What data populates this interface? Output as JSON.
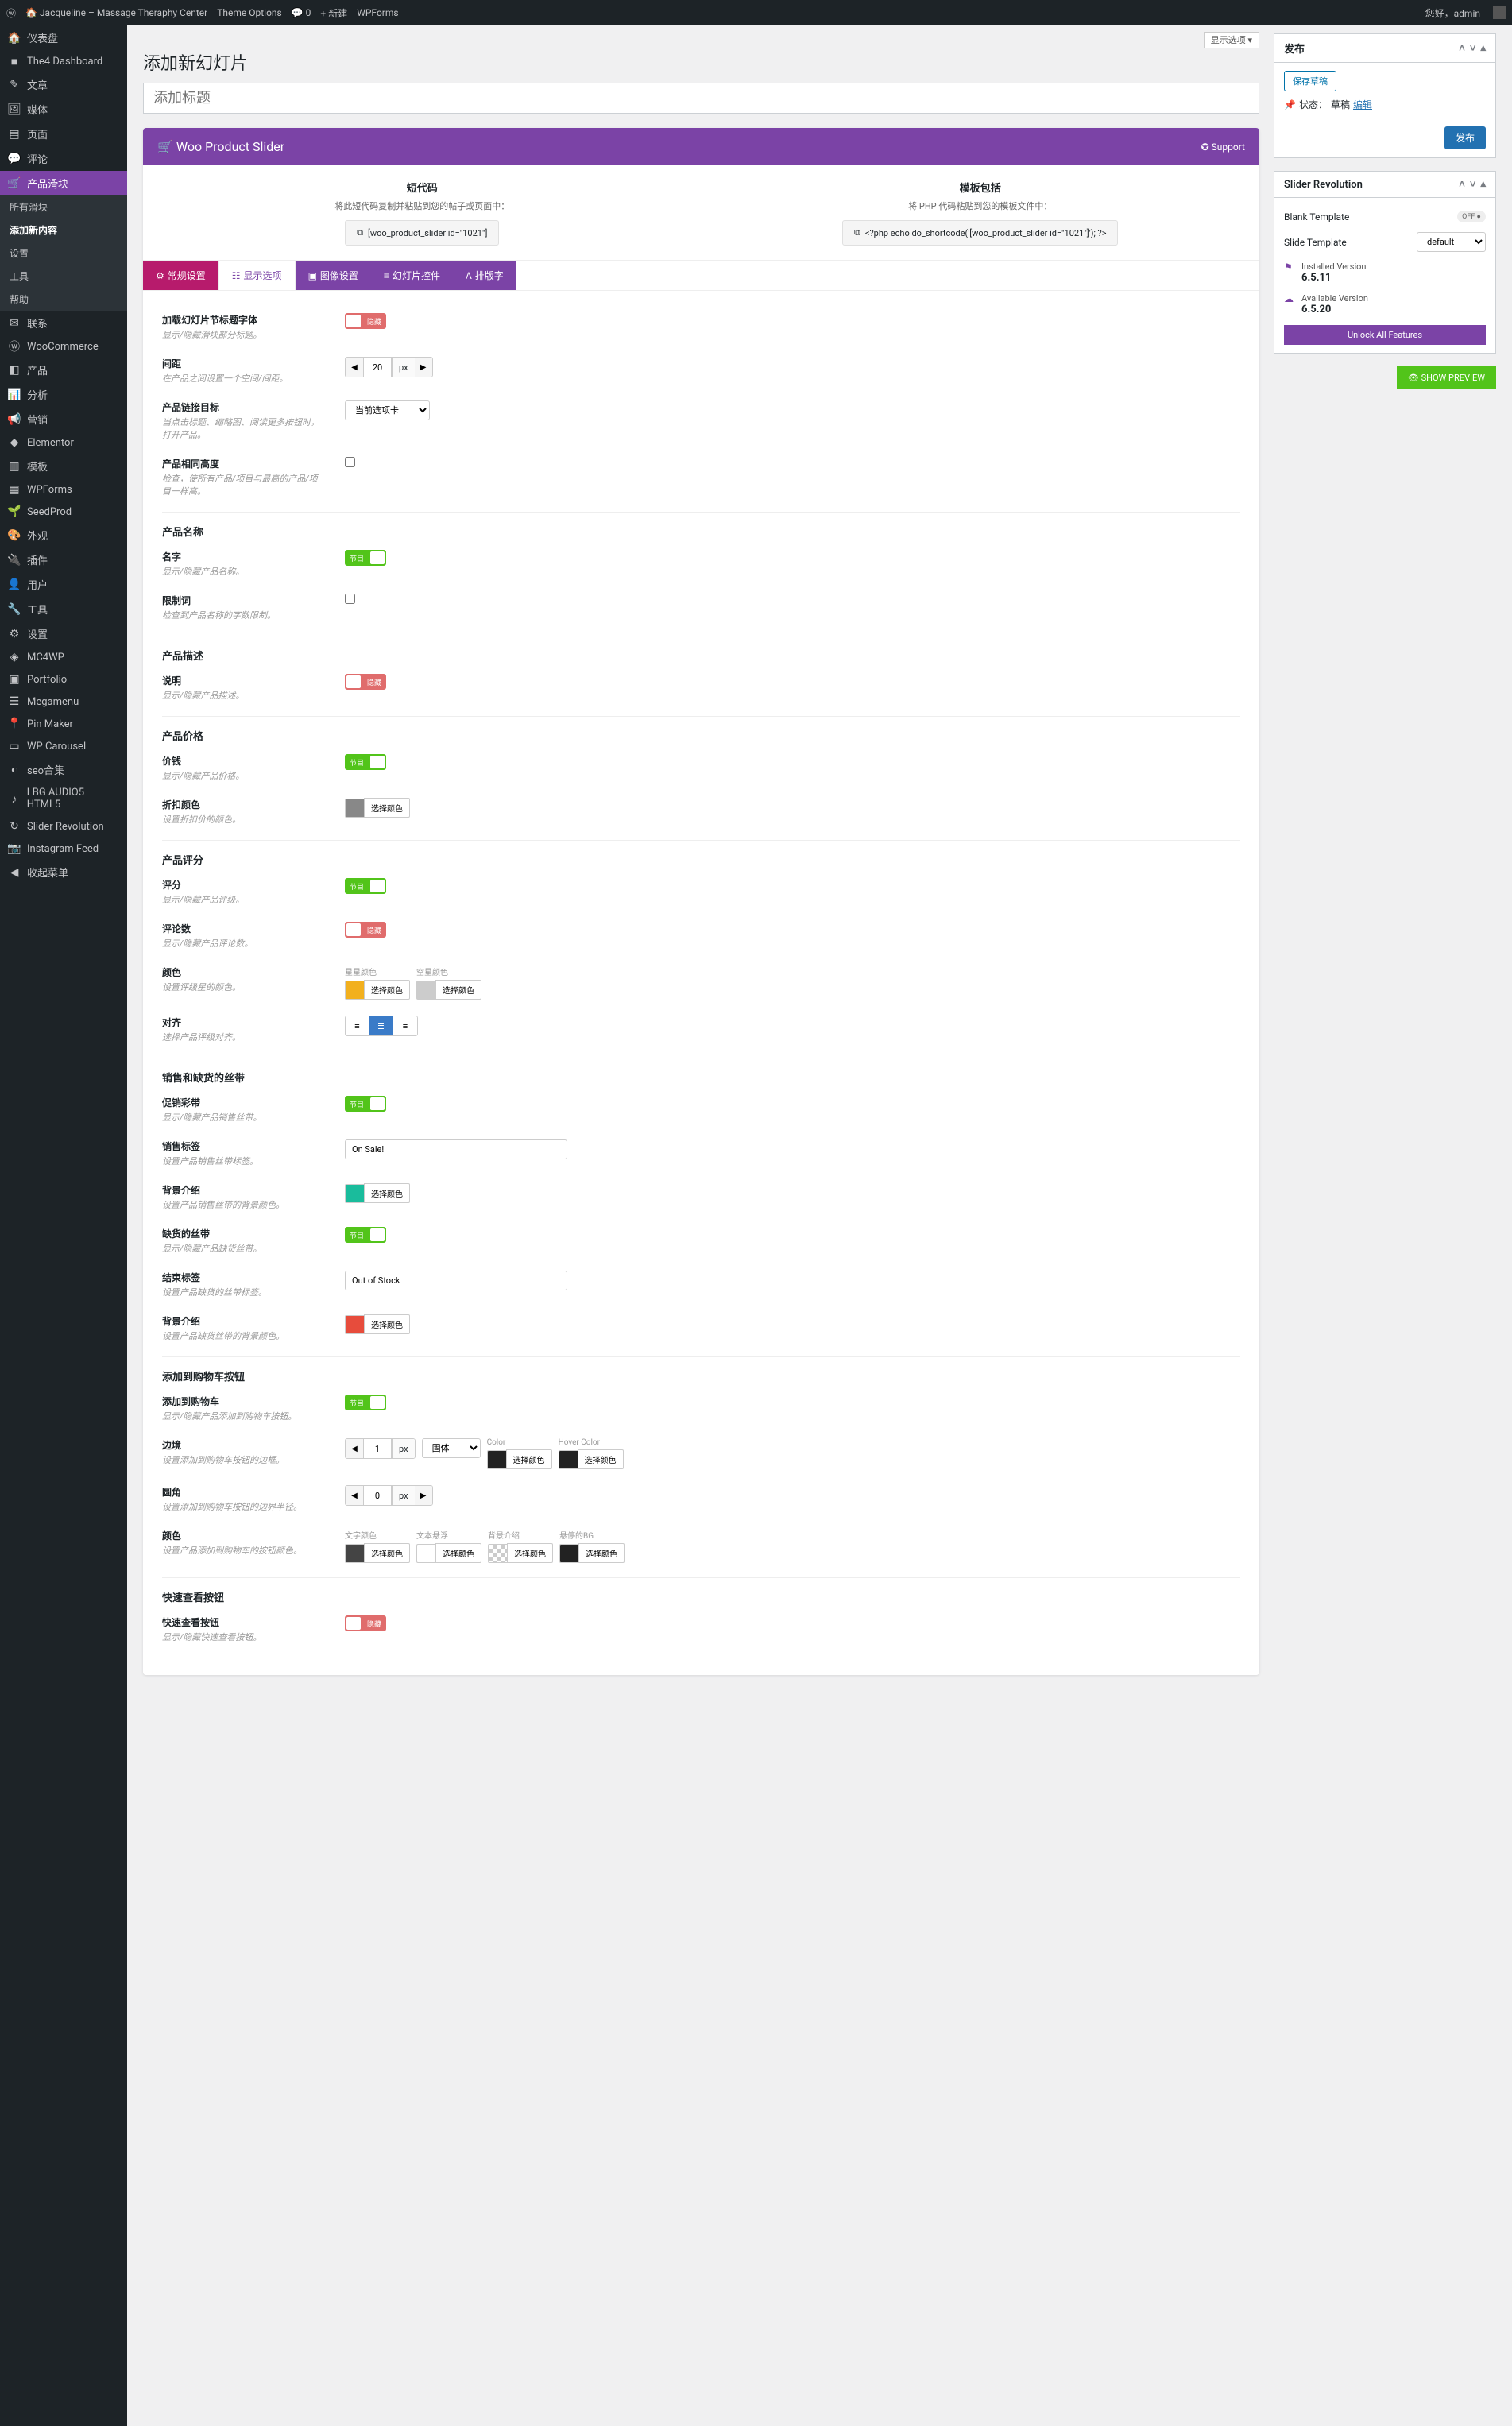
{
  "topbar": {
    "site": "Jacqueline – Massage Theraphy Center",
    "theme_options": "Theme Options",
    "comments": "0",
    "new": "新建",
    "wpforms": "WPForms",
    "greeting": "您好，admin"
  },
  "display_options": "显示选项 ▾",
  "sidebar": {
    "items": [
      {
        "icon": "🏠",
        "label": "仪表盘"
      },
      {
        "icon": "■",
        "label": "The4 Dashboard"
      },
      {
        "icon": "✎",
        "label": "文章"
      },
      {
        "icon": "🖼",
        "label": "媒体"
      },
      {
        "icon": "▤",
        "label": "页面"
      },
      {
        "icon": "💬",
        "label": "评论"
      },
      {
        "icon": "🛒",
        "label": "产品滑块",
        "active": true,
        "submenu": [
          "所有滑块",
          "添加新内容",
          "设置",
          "工具",
          "帮助"
        ]
      },
      {
        "icon": "✉",
        "label": "联系"
      },
      {
        "icon": "ⓦ",
        "label": "WooCommerce"
      },
      {
        "icon": "◧",
        "label": "产品"
      },
      {
        "icon": "📊",
        "label": "分析"
      },
      {
        "icon": "📢",
        "label": "营销"
      },
      {
        "icon": "◆",
        "label": "Elementor"
      },
      {
        "icon": "▥",
        "label": "模板"
      },
      {
        "icon": "▦",
        "label": "WPForms"
      },
      {
        "icon": "🌱",
        "label": "SeedProd"
      },
      {
        "icon": "🎨",
        "label": "外观"
      },
      {
        "icon": "🔌",
        "label": "插件"
      },
      {
        "icon": "👤",
        "label": "用户"
      },
      {
        "icon": "🔧",
        "label": "工具"
      },
      {
        "icon": "⚙",
        "label": "设置"
      },
      {
        "icon": "◈",
        "label": "MC4WP"
      },
      {
        "icon": "▣",
        "label": "Portfolio"
      },
      {
        "icon": "☰",
        "label": "Megamenu"
      },
      {
        "icon": "📍",
        "label": "Pin Maker"
      },
      {
        "icon": "▭",
        "label": "WP Carousel"
      },
      {
        "icon": "◐",
        "label": "seo合集"
      },
      {
        "icon": "♪",
        "label": "LBG AUDIO5 HTML5"
      },
      {
        "icon": "↻",
        "label": "Slider Revolution"
      },
      {
        "icon": "📷",
        "label": "Instagram Feed"
      },
      {
        "icon": "◀",
        "label": "收起菜单"
      }
    ]
  },
  "page": {
    "title": "添加新幻灯片",
    "title_placeholder": "添加标题"
  },
  "slider": {
    "brand": "Woo Product Slider",
    "support": "Support",
    "shortcode": {
      "title": "短代码",
      "desc": "将此短代码复制并粘贴到您的帖子或页面中：",
      "code": "[woo_product_slider id=\"1021\"]"
    },
    "template": {
      "title": "模板包括",
      "desc": "将 PHP 代码粘贴到您的模板文件中：",
      "code": "<?php echo do_shortcode('[woo_product_slider id=\"1021\"]'); ?>"
    }
  },
  "tabs": [
    "常规设置",
    "显示选项",
    "图像设置",
    "幻灯片控件",
    "排版字"
  ],
  "options": {
    "sec_title": {
      "lbl": "加载幻灯片节标题字体",
      "desc": "显示/隐藏滑块部分标题。"
    },
    "gap": {
      "lbl": "间距",
      "desc": "在产品之间设置一个空间/间距。",
      "val": "20",
      "unit": "px"
    },
    "link_target": {
      "lbl": "产品链接目标",
      "desc": "当点击标题、缩略图、阅读更多按钮时，打开产品。",
      "val": "当前选项卡"
    },
    "same_height": {
      "lbl": "产品相同高度",
      "desc": "检查，使所有产品/项目与最高的产品/项目一样高。"
    },
    "cat_name": "产品名称",
    "name": {
      "lbl": "名字",
      "desc": "显示/隐藏产品名称。"
    },
    "limit": {
      "lbl": "限制词",
      "desc": "检查到产品名称的字数限制。"
    },
    "cat_desc": "产品描述",
    "desc": {
      "lbl": "说明",
      "desc": "显示/隐藏产品描述。"
    },
    "cat_price": "产品价格",
    "price": {
      "lbl": "价钱",
      "desc": "显示/隐藏产品价格。"
    },
    "discount_color": {
      "lbl": "折扣颜色",
      "desc": "设置折扣价的颜色。",
      "btn": "选择颜色"
    },
    "cat_rating": "产品评分",
    "rating": {
      "lbl": "评分",
      "desc": "显示/隐藏产品评级。"
    },
    "review_count": {
      "lbl": "评论数",
      "desc": "显示/隐藏产品评论数。"
    },
    "colors": {
      "lbl": "颜色",
      "desc": "设置评级星的颜色。",
      "star": "星星颜色",
      "empty": "空星颜色",
      "btn": "选择颜色"
    },
    "align": {
      "lbl": "对齐",
      "desc": "选择产品评级对齐。"
    },
    "cat_ribbon": "销售和缺货的丝带",
    "sale_ribbon": {
      "lbl": "促销彩带",
      "desc": "显示/隐藏产品销售丝带。"
    },
    "sale_label": {
      "lbl": "销售标签",
      "desc": "设置产品销售丝带标签。",
      "val": "On Sale!"
    },
    "sale_bg": {
      "lbl": "背景介绍",
      "desc": "设置产品销售丝带的背景颜色。",
      "btn": "选择颜色"
    },
    "oos_ribbon": {
      "lbl": "缺货的丝带",
      "desc": "显示/隐藏产品缺货丝带。"
    },
    "oos_label": {
      "lbl": "结束标签",
      "desc": "设置产品缺货的丝带标签。",
      "val": "Out of Stock"
    },
    "oos_bg": {
      "lbl": "背景介绍",
      "desc": "设置产品缺货丝带的背景颜色。",
      "btn": "选择颜色"
    },
    "cat_cart": "添加到购物车按钮",
    "add_cart": {
      "lbl": "添加到购物车",
      "desc": "显示/隐藏产品添加到购物车按钮。"
    },
    "border": {
      "lbl": "边境",
      "desc": "设置添加到购物车按钮的边框。",
      "val": "1",
      "unit": "px",
      "style": "固体",
      "c1": "Color",
      "c2": "Hover Color",
      "btn": "选择颜色"
    },
    "radius": {
      "lbl": "圆角",
      "desc": "设置添加到购物车按钮的边界半径。",
      "val": "0",
      "unit": "px"
    },
    "btn_colors": {
      "lbl": "颜色",
      "desc": "设置产品添加到购物车的按钮颜色。",
      "c1": "文字颜色",
      "c2": "文本悬浮",
      "c3": "背景介绍",
      "c4": "悬停的BG",
      "btn": "选择颜色"
    },
    "cat_quick": "快速查看按钮",
    "quick_view": {
      "lbl": "快速查看按钮",
      "desc": "显示/隐藏快速查看按钮。"
    }
  },
  "publish": {
    "title": "发布",
    "save_draft": "保存草稿",
    "status": "状态：",
    "status_val": "草稿",
    "edit": "编辑",
    "publish_btn": "发布"
  },
  "revolution": {
    "title": "Slider Revolution",
    "blank": "Blank Template",
    "off": "OFF",
    "slide": "Slide Template",
    "default": "default",
    "installed": "Installed Version",
    "installed_v": "6.5.11",
    "available": "Available Version",
    "available_v": "6.5.20",
    "unlock": "Unlock All Features"
  },
  "preview_btn": "SHOW PREVIEW"
}
